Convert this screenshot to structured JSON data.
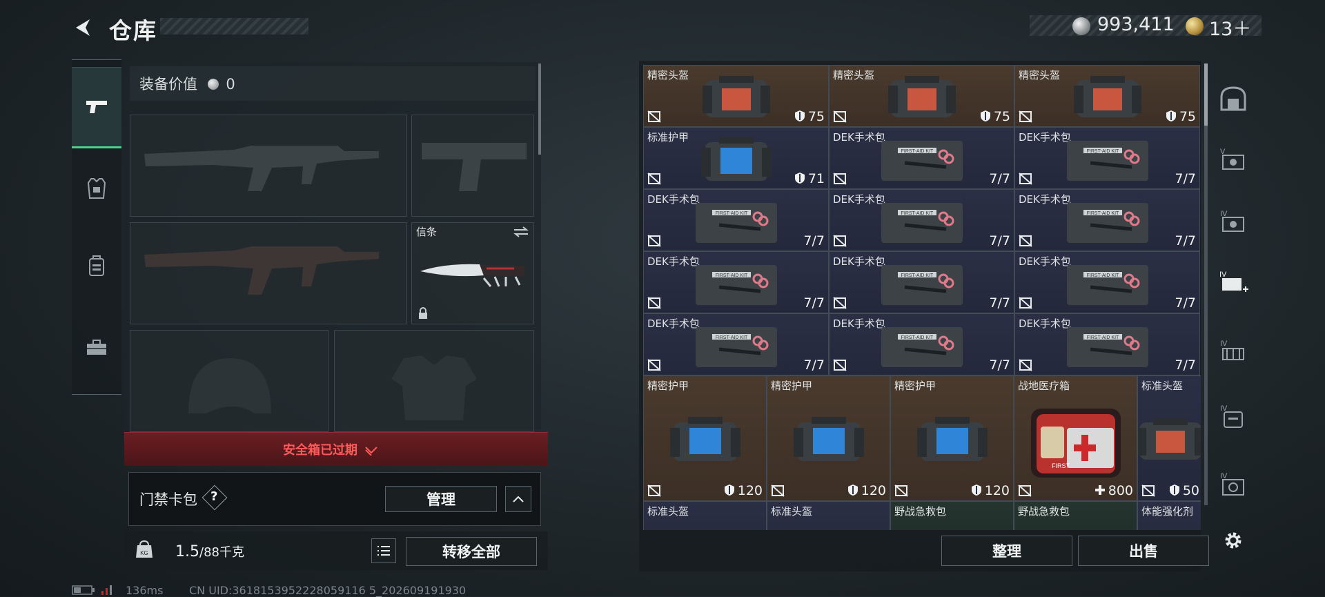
{
  "header": {
    "title": "仓库",
    "silver_amount": "993,411",
    "gold_amount": "13＋"
  },
  "left_tabs": [
    {
      "name": "tab-weapons",
      "icon": "pistol-icon",
      "active": true
    },
    {
      "name": "tab-armor",
      "icon": "armor-vest-icon",
      "active": false
    },
    {
      "name": "tab-backpack",
      "icon": "backpack-icon",
      "active": false
    },
    {
      "name": "tab-toolbox",
      "icon": "toolbox-icon",
      "active": false
    }
  ],
  "loadout": {
    "value_label": "装备价值",
    "value": "0",
    "knife_label": "信条",
    "safe_box_status": "安全箱已过期",
    "card_pack_label": "门禁卡包",
    "card_pack_help": "?",
    "manage_button": "管理",
    "weight_current": "1.5",
    "weight_max": "/88千克",
    "transfer_all_button": "转移全部"
  },
  "status_bar": {
    "ping": "136ms",
    "uid": "CN UID:3618153952228059116 5_202609191930"
  },
  "storage": {
    "rows": [
      [
        {
          "name": "精密头盔",
          "value": "75",
          "kind": "helmet",
          "bg": "brown"
        },
        {
          "name": "精密头盔",
          "value": "75",
          "kind": "helmet",
          "bg": "brown"
        },
        {
          "name": "精密头盔",
          "value": "75",
          "kind": "helmet",
          "bg": "brown"
        }
      ],
      [
        {
          "name": "标准护甲",
          "value": "71",
          "kind": "armor",
          "bg": "navy"
        },
        {
          "name": "DEK手术包",
          "value": "7/7",
          "kind": "medkit",
          "bg": "navy"
        },
        {
          "name": "DEK手术包",
          "value": "7/7",
          "kind": "medkit",
          "bg": "navy"
        }
      ],
      [
        {
          "name": "DEK手术包",
          "value": "7/7",
          "kind": "medkit",
          "bg": "navy"
        },
        {
          "name": "DEK手术包",
          "value": "7/7",
          "kind": "medkit",
          "bg": "navy"
        },
        {
          "name": "DEK手术包",
          "value": "7/7",
          "kind": "medkit",
          "bg": "navy"
        }
      ],
      [
        {
          "name": "DEK手术包",
          "value": "7/7",
          "kind": "medkit",
          "bg": "navy"
        },
        {
          "name": "DEK手术包",
          "value": "7/7",
          "kind": "medkit",
          "bg": "navy"
        },
        {
          "name": "DEK手术包",
          "value": "7/7",
          "kind": "medkit",
          "bg": "navy"
        }
      ],
      [
        {
          "name": "DEK手术包",
          "value": "7/7",
          "kind": "medkit",
          "bg": "navy"
        },
        {
          "name": "DEK手术包",
          "value": "7/7",
          "kind": "medkit",
          "bg": "navy"
        },
        {
          "name": "DEK手术包",
          "value": "7/7",
          "kind": "medkit",
          "bg": "navy"
        }
      ]
    ],
    "big_row": [
      {
        "name": "精密护甲",
        "value": "120",
        "kind": "armor",
        "bg": "brown"
      },
      {
        "name": "精密护甲",
        "value": "120",
        "kind": "armor",
        "bg": "brown"
      },
      {
        "name": "精密护甲",
        "value": "120",
        "kind": "armor",
        "bg": "brown"
      },
      {
        "name": "战地医疗箱",
        "value": "800",
        "kind": "firstaid",
        "bg": "brown"
      },
      {
        "name": "标准头盔",
        "value": "50",
        "kind": "helmet",
        "bg": "navy"
      }
    ],
    "partial_row": [
      "标准头盔",
      "标准头盔",
      "野战急救包",
      "野战急救包",
      "体能强化剂"
    ],
    "sort_button": "整理",
    "sell_button": "出售"
  },
  "side_icons": [
    "helmet-slot-icon",
    "armor-lvl5-icon",
    "armor-lvl4-icon",
    "armor-lvl4-add-icon",
    "rig-lvl4-icon",
    "backpack-lvl4-icon",
    "case-lvl4-icon",
    "settings-gear-icon"
  ],
  "colors": {
    "accent_green": "#4fd18b",
    "expired_red": "#ff5a5a",
    "cell_brown": "#4a3a2e",
    "cell_navy": "#2a2f45"
  }
}
